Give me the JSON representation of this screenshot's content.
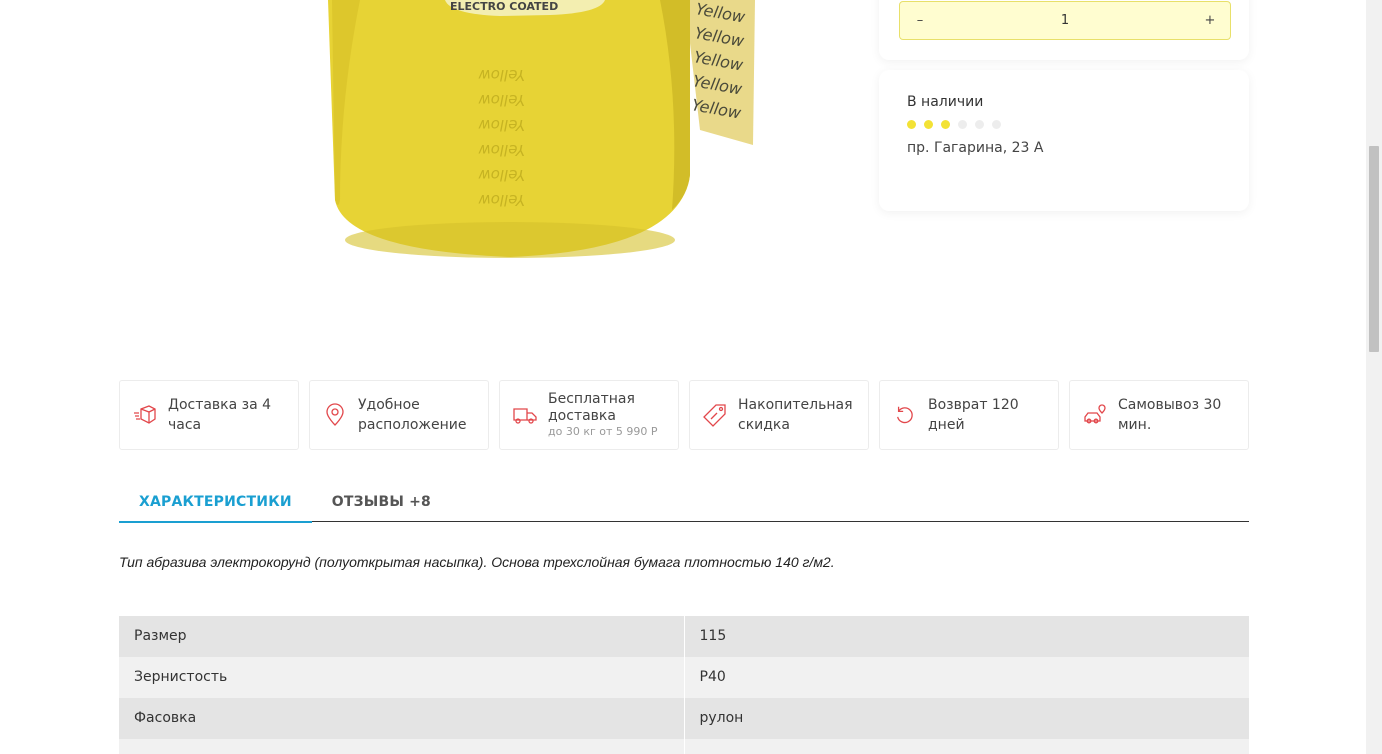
{
  "quantity": {
    "minus": "–",
    "value": "1",
    "plus": "+"
  },
  "availability": {
    "status": "В наличии",
    "stock_level": 3,
    "stock_max": 6,
    "address": "пр. Гагарина, 23 А"
  },
  "features": [
    {
      "icon": "delivery-box-icon",
      "label": "Доставка за 4 часа"
    },
    {
      "icon": "location-pin-icon",
      "label": "Удобное расположение"
    },
    {
      "icon": "truck-icon",
      "label": "Бесплатная доставка",
      "sub": "до 30 кг от 5 990 Р"
    },
    {
      "icon": "discount-tag-icon",
      "label": "Накопительная скидка"
    },
    {
      "icon": "return-arrow-icon",
      "label": "Возврат 120 дней"
    },
    {
      "icon": "car-pickup-icon",
      "label": "Самовывоз 30 мин."
    }
  ],
  "tabs": [
    {
      "label": "ХАРАКТЕРИСТИКИ",
      "active": true
    },
    {
      "label": "ОТЗЫВЫ +8",
      "active": false
    }
  ],
  "description": "Тип абразива электрокорунд (полуоткрытая насыпка). Основа трехслойная бумага плотностью 140 г/м2.",
  "specs": [
    {
      "name": "Размер",
      "value": "115"
    },
    {
      "name": "Зернистость",
      "value": "P40"
    },
    {
      "name": "Фасовка",
      "value": "рулон"
    },
    {
      "name": "",
      "value": ""
    }
  ],
  "colors": {
    "accent": "#1a9fd1",
    "icon_red": "#e2474b",
    "dot_on": "#f3e235",
    "qty_bg": "#fffdd0"
  }
}
